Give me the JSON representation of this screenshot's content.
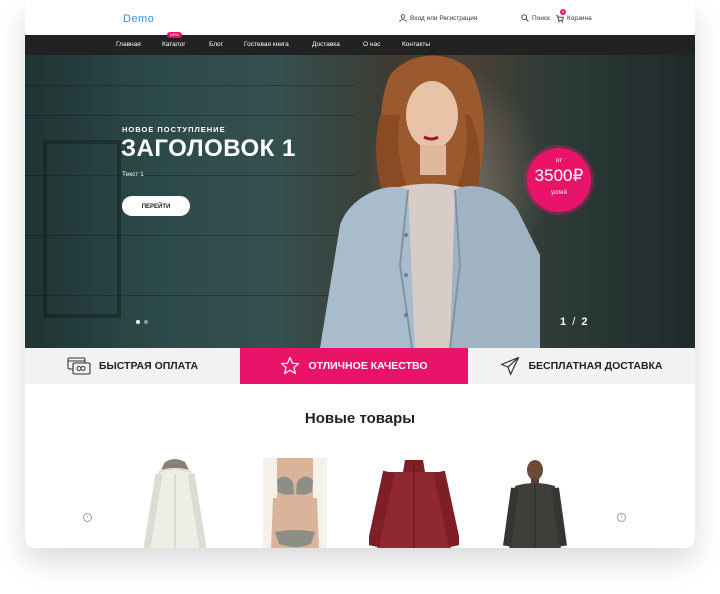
{
  "header": {
    "logo": "Demo",
    "login_label": "Вход или Регистрация",
    "search_label": "Поиск",
    "cart_label": "Корзина",
    "cart_count": "0"
  },
  "nav": {
    "items": [
      "Главная",
      "Каталог",
      "Блог",
      "Гостевая книга",
      "Доставка",
      "О нас",
      "Контакты"
    ],
    "new_badge": "NEW"
  },
  "hero": {
    "subtitle": "НОВОЕ ПОСТУПЛЕНИЕ",
    "title": "ЗАГОЛОВОК 1",
    "text": "Текст 1",
    "button": "ПЕРЕЙТИ",
    "price_prefix": "от",
    "price": "3500₽",
    "price_note": "успей",
    "pager_current": "1",
    "pager_sep": "/",
    "pager_total": "2",
    "active_slide": 1
  },
  "features": [
    {
      "label": "БЫСТРАЯ ОПЛАТА",
      "icon": "card-payment-icon"
    },
    {
      "label": "ОТЛИЧНОЕ КАЧЕСТВО",
      "icon": "star-icon"
    },
    {
      "label": "БЕСПЛАТНАЯ ДОСТАВКА",
      "icon": "paper-plane-icon"
    }
  ],
  "products": {
    "title": "Новые товары",
    "items": [
      {
        "name": "white-parka"
      },
      {
        "name": "bikini"
      },
      {
        "name": "red-fleece-jacket"
      },
      {
        "name": "gray-mens-jacket"
      }
    ]
  },
  "colors": {
    "accent": "#e9146a",
    "nav_bg": "#222222",
    "logo": "#3a8be0",
    "feature_bg": "#f2f2f2"
  }
}
